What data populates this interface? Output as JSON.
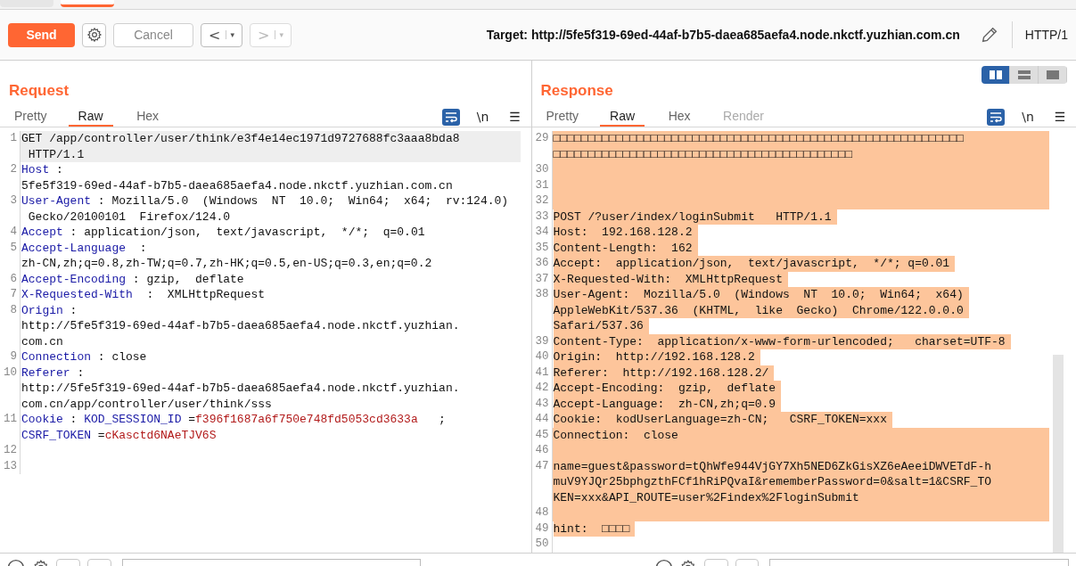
{
  "toolbar": {
    "send": "Send",
    "cancel": "Cancel",
    "nav": [
      {
        "arrow": "<",
        "caret": "▾",
        "disabled": false
      },
      {
        "arrow": ">",
        "caret": "▾",
        "disabled": true
      }
    ],
    "target_label": "Target:",
    "target": "http://5fe5f319-69ed-44af-b7b5-daea685aefa4.node.nkctf.yuzhian.com.cn",
    "protocol": "HTTP/1"
  },
  "request": {
    "title": "Request",
    "tabs": [
      {
        "label": "Pretty",
        "selected": false,
        "disabled": false
      },
      {
        "label": "Raw",
        "selected": true,
        "disabled": false
      },
      {
        "label": "Hex",
        "selected": false,
        "disabled": false
      }
    ],
    "tools": [
      {
        "kind": "wrap",
        "selected": true
      },
      {
        "kind": "text",
        "label": "\\n"
      },
      {
        "kind": "text",
        "label": "☰"
      }
    ],
    "lines": [
      {
        "number": "1",
        "current": true,
        "rows": [
          {
            "segments": [
              {
                "kind": "plain",
                "text": "GET /app/controller/user/think/e3f4e14ec1971d9727688fc3aaa8bda8"
              }
            ]
          },
          {
            "segments": [
              {
                "kind": "plain",
                "text": " HTTP/1.1"
              }
            ]
          }
        ]
      },
      {
        "number": "2",
        "current": false,
        "rows": [
          {
            "segments": [
              {
                "kind": "name",
                "text": "Host"
              },
              {
                "kind": "plain",
                "text": " :"
              }
            ]
          },
          {
            "segments": [
              {
                "kind": "plain",
                "text": "5fe5f319-69ed-44af-b7b5-daea685aefa4.node.nkctf.yuzhian.com.cn"
              }
            ]
          }
        ]
      },
      {
        "number": "3",
        "current": false,
        "rows": [
          {
            "segments": [
              {
                "kind": "name",
                "text": "User-Agent"
              },
              {
                "kind": "plain",
                "text": " : Mozilla/5.0  (Windows  NT  10.0;  Win64;  x64;  rv:124.0)"
              }
            ]
          },
          {
            "segments": [
              {
                "kind": "plain",
                "text": " Gecko/20100101  Firefox/124.0"
              }
            ]
          }
        ]
      },
      {
        "number": "4",
        "current": false,
        "rows": [
          {
            "segments": [
              {
                "kind": "name",
                "text": "Accept"
              },
              {
                "kind": "plain",
                "text": " : application/json,  text/javascript,  */*;  q=0.01"
              }
            ]
          }
        ]
      },
      {
        "number": "5",
        "current": false,
        "rows": [
          {
            "segments": [
              {
                "kind": "name",
                "text": "Accept-Language"
              },
              {
                "kind": "plain",
                "text": "  :"
              }
            ]
          },
          {
            "segments": [
              {
                "kind": "plain",
                "text": "zh-CN,zh;q=0.8,zh-TW;q=0.7,zh-HK;q=0.5,en-US;q=0.3,en;q=0.2"
              }
            ]
          }
        ]
      },
      {
        "number": "6",
        "current": false,
        "rows": [
          {
            "segments": [
              {
                "kind": "name",
                "text": "Accept-Encoding"
              },
              {
                "kind": "plain",
                "text": " : gzip,  deflate"
              }
            ]
          }
        ]
      },
      {
        "number": "7",
        "current": false,
        "rows": [
          {
            "segments": [
              {
                "kind": "name",
                "text": "X-Requested-With"
              },
              {
                "kind": "plain",
                "text": "  :  XMLHttpRequest"
              }
            ]
          }
        ]
      },
      {
        "number": "8",
        "current": false,
        "rows": [
          {
            "segments": [
              {
                "kind": "name",
                "text": "Origin"
              },
              {
                "kind": "plain",
                "text": " :"
              }
            ]
          },
          {
            "segments": [
              {
                "kind": "plain",
                "text": "http://5fe5f319-69ed-44af-b7b5-daea685aefa4.node.nkctf.yuzhian."
              }
            ]
          },
          {
            "segments": [
              {
                "kind": "plain",
                "text": "com.cn"
              }
            ]
          }
        ]
      },
      {
        "number": "9",
        "current": false,
        "rows": [
          {
            "segments": [
              {
                "kind": "name",
                "text": "Connection"
              },
              {
                "kind": "plain",
                "text": " : close"
              }
            ]
          }
        ]
      },
      {
        "number": "10",
        "current": false,
        "rows": [
          {
            "segments": [
              {
                "kind": "name",
                "text": "Referer"
              },
              {
                "kind": "plain",
                "text": " :"
              }
            ]
          },
          {
            "segments": [
              {
                "kind": "plain",
                "text": "http://5fe5f319-69ed-44af-b7b5-daea685aefa4.node.nkctf.yuzhian."
              }
            ]
          },
          {
            "segments": [
              {
                "kind": "plain",
                "text": "com.cn/app/controller/user/think/sss"
              }
            ]
          }
        ]
      },
      {
        "number": "11",
        "current": false,
        "rows": [
          {
            "segments": [
              {
                "kind": "name",
                "text": "Cookie"
              },
              {
                "kind": "plain",
                "text": " : "
              },
              {
                "kind": "name",
                "text": "KOD_SESSION_ID"
              },
              {
                "kind": "plain",
                "text": " ="
              },
              {
                "kind": "value",
                "text": "f396f1687a6f750e748fd5053cd3633a"
              },
              {
                "kind": "plain",
                "text": "   ;"
              }
            ]
          },
          {
            "segments": [
              {
                "kind": "name",
                "text": "CSRF_TOKEN"
              },
              {
                "kind": "plain",
                "text": " ="
              },
              {
                "kind": "value",
                "text": "cKasctd6NAeTJV6S"
              }
            ]
          }
        ]
      },
      {
        "number": "12",
        "current": false
      },
      {
        "number": "13",
        "current": false
      }
    ]
  },
  "response": {
    "title": "Response",
    "layout_buttons": [
      {
        "kind": "side",
        "selected": true
      },
      {
        "kind": "stacked",
        "selected": false
      },
      {
        "kind": "single",
        "selected": false
      }
    ],
    "tabs": [
      {
        "label": "Pretty",
        "selected": false,
        "disabled": false
      },
      {
        "label": "Raw",
        "selected": true,
        "disabled": false
      },
      {
        "label": "Hex",
        "selected": false,
        "disabled": false
      },
      {
        "label": "Render",
        "selected": false,
        "disabled": true
      }
    ],
    "tools": [
      {
        "kind": "wrap",
        "selected": true
      },
      {
        "kind": "text",
        "label": "\\n"
      },
      {
        "kind": "text",
        "label": "☰"
      }
    ],
    "lines": [
      {
        "number": "29",
        "highlighted": true,
        "full_width": true,
        "rows": [
          "□□□□□□□□□□□□□□□□□□□□□□□□□□□□□□□□□□□□□□□□□□□□□□□□□□□□□□□□□□□",
          "□□□□□□□□□□□□□□□□□□□□□□□□□□□□□□□□□□□□□□□□□□□"
        ]
      },
      {
        "number": "30",
        "highlighted": true,
        "full_width": true
      },
      {
        "number": "31",
        "highlighted": true,
        "full_width": true
      },
      {
        "number": "32",
        "highlighted": true,
        "full_width": true
      },
      {
        "number": "33",
        "highlighted": true,
        "full_width": false,
        "rows": [
          "POST /?user/index/loginSubmit   HTTP/1.1"
        ]
      },
      {
        "number": "34",
        "highlighted": true,
        "full_width": false,
        "rows": [
          "Host:  192.168.128.2"
        ]
      },
      {
        "number": "35",
        "highlighted": true,
        "full_width": false,
        "rows": [
          "Content-Length:  162"
        ]
      },
      {
        "number": "36",
        "highlighted": true,
        "full_width": false,
        "rows": [
          "Accept:  application/json,  text/javascript,  */*; q=0.01"
        ]
      },
      {
        "number": "37",
        "highlighted": true,
        "full_width": false,
        "rows": [
          "X-Requested-With:  XMLHttpRequest"
        ]
      },
      {
        "number": "38",
        "highlighted": true,
        "full_width": false,
        "rows": [
          "User-Agent:  Mozilla/5.0  (Windows  NT  10.0;  Win64;  x64)",
          "AppleWebKit/537.36  (KHTML,  like  Gecko)  Chrome/122.0.0.0",
          "Safari/537.36"
        ]
      },
      {
        "number": "39",
        "highlighted": true,
        "full_width": false,
        "rows": [
          "Content-Type:  application/x-www-form-urlencoded;   charset=UTF-8"
        ]
      },
      {
        "number": "40",
        "highlighted": true,
        "full_width": false,
        "rows": [
          "Origin:  http://192.168.128.2"
        ]
      },
      {
        "number": "41",
        "highlighted": true,
        "full_width": false,
        "rows": [
          "Referer:  http://192.168.128.2/"
        ]
      },
      {
        "number": "42",
        "highlighted": true,
        "full_width": false,
        "rows": [
          "Accept-Encoding:  gzip,  deflate"
        ]
      },
      {
        "number": "43",
        "highlighted": true,
        "full_width": false,
        "rows": [
          "Accept-Language:  zh-CN,zh;q=0.9"
        ]
      },
      {
        "number": "44",
        "highlighted": true,
        "full_width": false,
        "rows": [
          "Cookie:  kodUserLanguage=zh-CN;   CSRF_TOKEN=xxx"
        ]
      },
      {
        "number": "45",
        "highlighted": true,
        "full_width": true,
        "rows": [
          "Connection:  close"
        ]
      },
      {
        "number": "46",
        "highlighted": true,
        "full_width": true
      },
      {
        "number": "47",
        "highlighted": true,
        "full_width": true,
        "rows": [
          "name=guest&password=tQhWfe944VjGY7Xh5NED6ZkGisXZ6eAeeiDWVETdF-h",
          "muV9YJQr25bphgzthFCf1hRiPQvaI&rememberPassword=0&salt=1&CSRF_TO",
          "KEN=xxx&API_ROUTE=user%2Findex%2FloginSubmit"
        ]
      },
      {
        "number": "48",
        "highlighted": true,
        "full_width": true
      },
      {
        "number": "49",
        "highlighted": true,
        "full_width": false,
        "rows": [
          "hint:  □□□□"
        ]
      },
      {
        "number": "50"
      }
    ]
  }
}
